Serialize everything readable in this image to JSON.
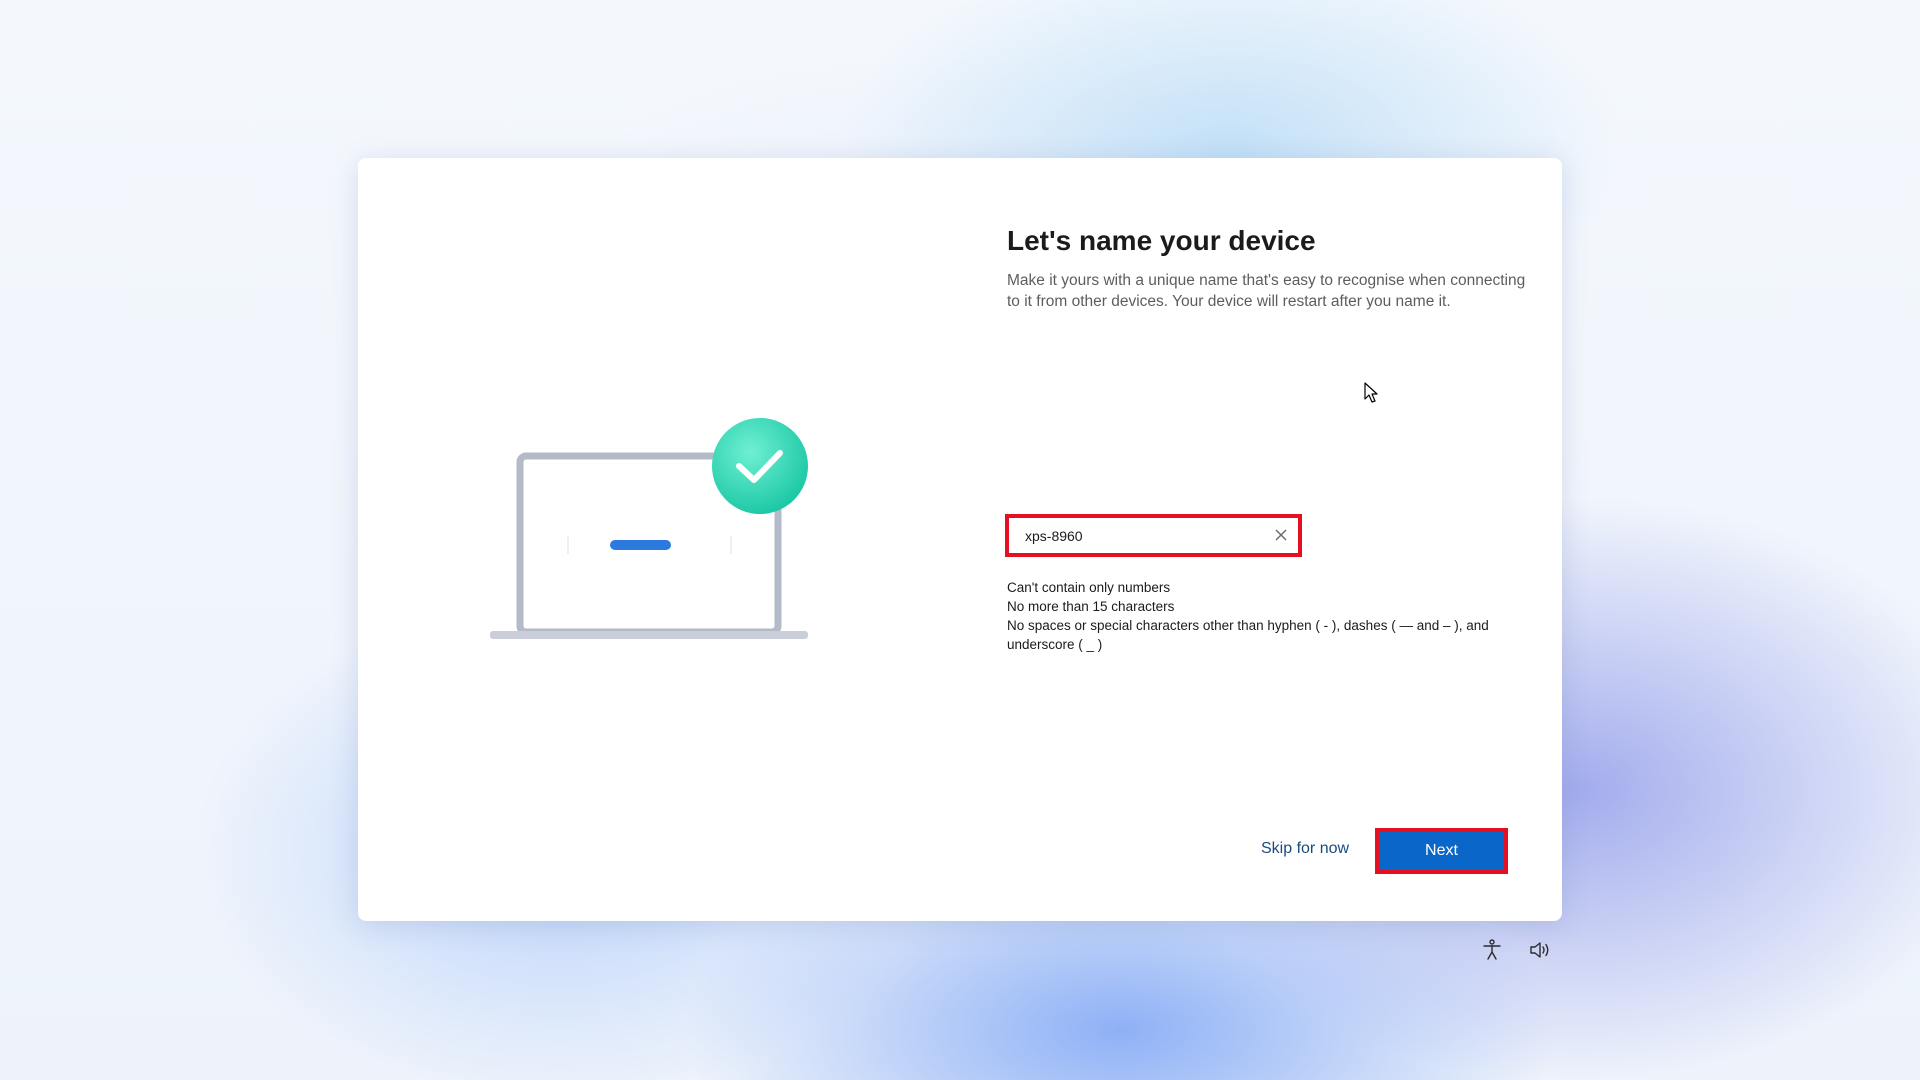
{
  "dialog": {
    "title": "Let's name your device",
    "description": "Make it yours with a unique name that's easy to recognise when connecting to it from other devices. Your device will restart after you name it."
  },
  "name_input": {
    "value": "xps-8960",
    "clear_icon": "close-icon"
  },
  "rules": [
    "Can't contain only numbers",
    "No more than 15 characters",
    "No spaces or special characters other than hyphen ( - ), dashes ( — and – ), and underscore ( _ )"
  ],
  "actions": {
    "skip_label": "Skip for now",
    "next_label": "Next"
  },
  "taskbar": {
    "accessibility_icon": "accessibility-icon",
    "volume_icon": "volume-icon"
  },
  "colors": {
    "accent": "#0a66c8",
    "highlight_border": "#e5101f",
    "check_badge": "#2ed7b4"
  }
}
